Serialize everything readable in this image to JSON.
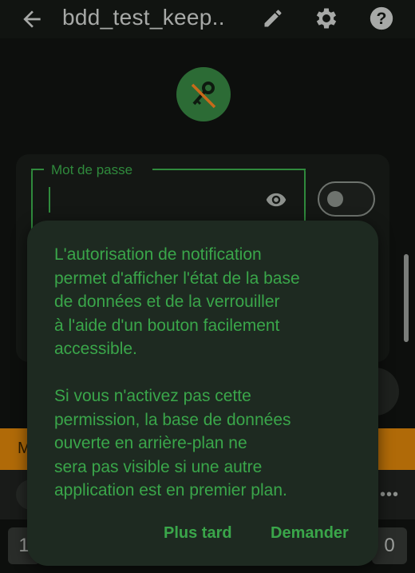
{
  "appbar": {
    "title": "bdd_test_keep..",
    "icons": [
      "arrow-back-icon",
      "pencil-icon",
      "gear-icon",
      "help-icon"
    ]
  },
  "form": {
    "password_label": "Mot de passe",
    "password_value": ""
  },
  "background": {
    "strip_text": "M",
    "key_left": "1",
    "key_right": "0",
    "more": "•••"
  },
  "dialog": {
    "message": "L'autorisation de notification\npermet d'afficher l'état de la base\nde données et de la verrouiller\nà l'aide d'un bouton facilement\naccessible.\n\nSi vous n'activez pas cette\npermission, la base de données\nouverte en arrière-plan ne\nsera pas visible si une autre\napplication est en premier plan.",
    "later_label": "Plus tard",
    "ask_label": "Demander"
  },
  "colors": {
    "accent": "#3aa64a",
    "dialog_bg": "#1e2a21",
    "warning_strip": "#b06a08"
  }
}
